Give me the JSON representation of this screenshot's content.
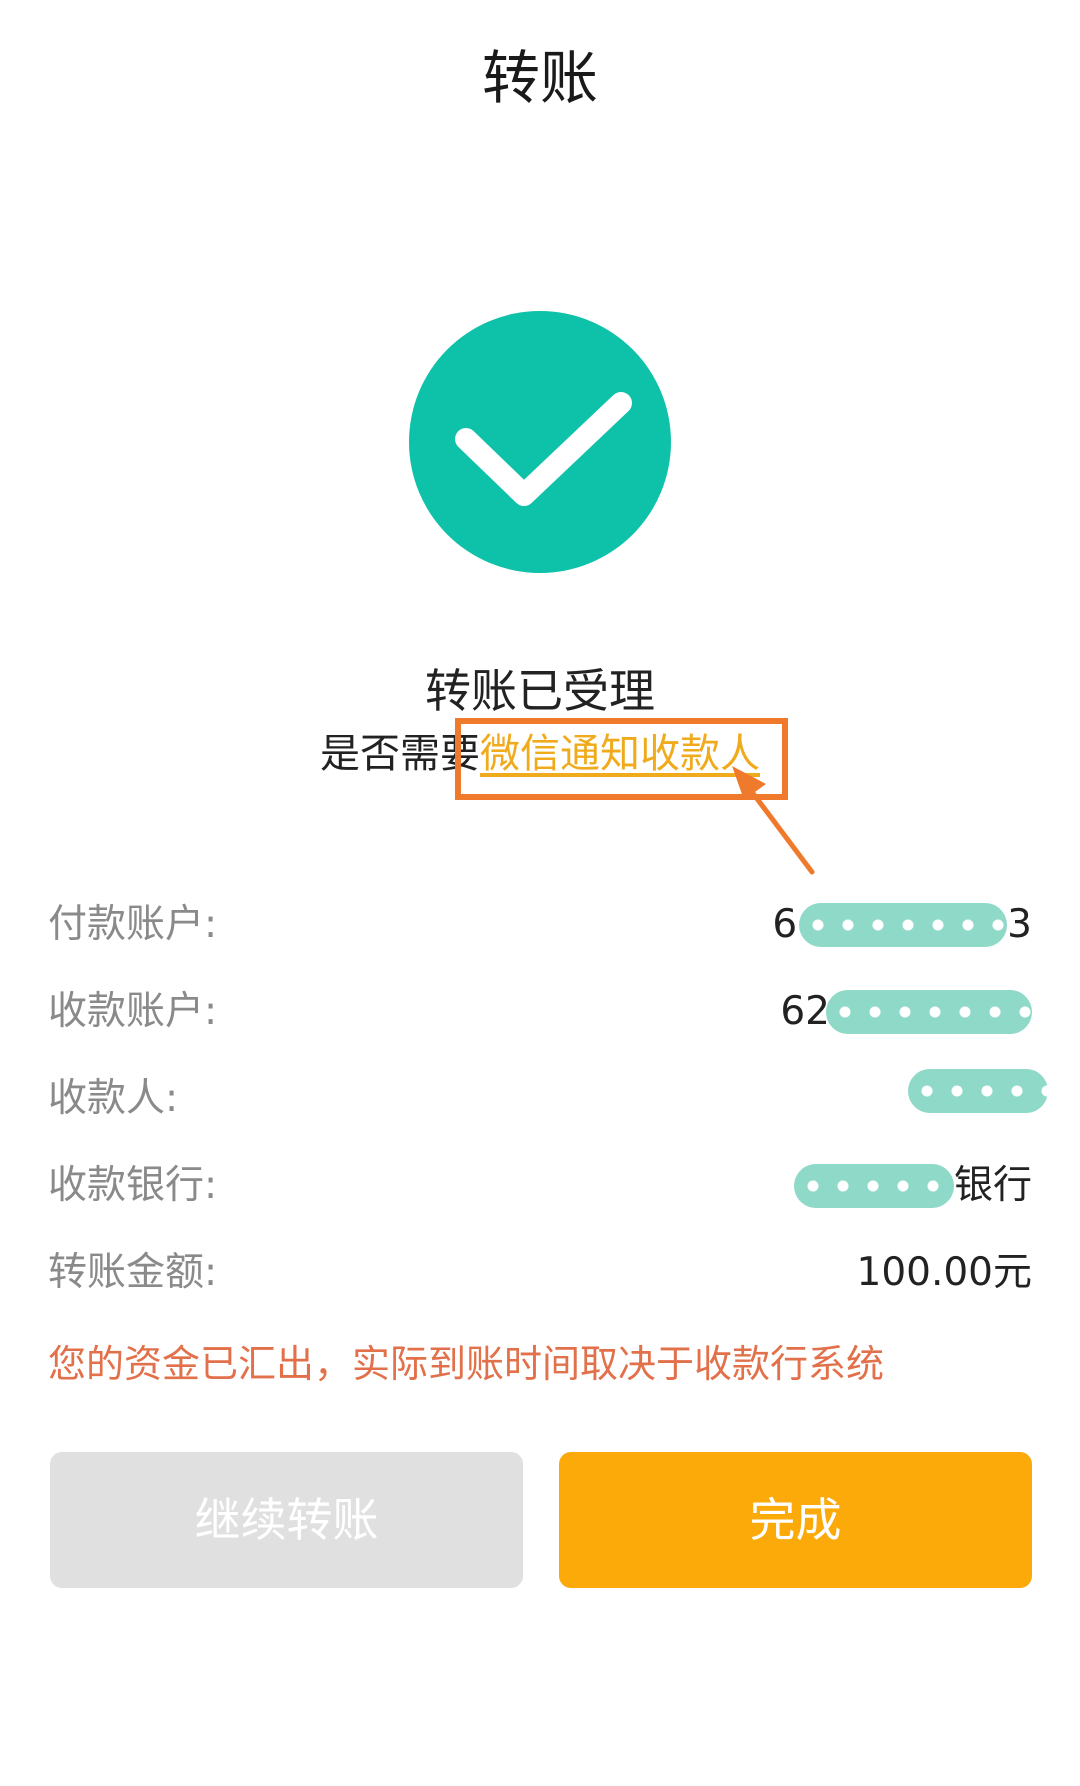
{
  "header": {
    "title": "转账"
  },
  "status": {
    "icon": "check-circle-icon",
    "icon_color": "#0ec1a9",
    "title": "转账已受理",
    "notify_prefix": "是否需要",
    "notify_link": "微信通知收款人"
  },
  "annotation": {
    "box_color": "#f07a2c"
  },
  "details": {
    "payer_account": {
      "label": "付款账户:",
      "value_head": "6",
      "value_tail": "3"
    },
    "payee_account": {
      "label": "收款账户:",
      "value_head": "62",
      "value_tail": ""
    },
    "payee_name": {
      "label": "收款人:"
    },
    "payee_bank": {
      "label": "收款银行:",
      "value_tail": "银行"
    },
    "amount": {
      "label": "转账金额:",
      "value": "100.00元"
    }
  },
  "notice": "您的资金已汇出，实际到账时间取决于收款行系统",
  "buttons": {
    "continue_label": "继续转账",
    "done_label": "完成",
    "done_color": "#fbaa0a"
  }
}
